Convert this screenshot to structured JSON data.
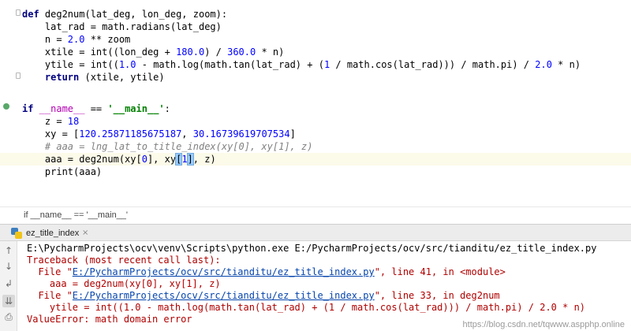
{
  "editor": {
    "lines": {
      "l1_def": "def",
      "l1_rest": " deg2num(lat_deg, lon_deg, zoom):",
      "l2": "    lat_rad = math.radians(lat_deg)",
      "l3_a": "    n = ",
      "l3_num": "2.0",
      "l3_b": " ** zoom",
      "l4_a": "    xtile = int((lon_deg + ",
      "l4_n1": "180.0",
      "l4_b": ") / ",
      "l4_n2": "360.0",
      "l4_c": " * n)",
      "l5_a": "    ytile = int((",
      "l5_n1": "1.0",
      "l5_b": " - math.log(math.tan(lat_rad) + (",
      "l5_n2": "1",
      "l5_c": " / math.cos(lat_rad))) / math.pi) / ",
      "l5_n3": "2.0",
      "l5_d": " * n)",
      "l6_kw": "    return",
      "l6_rest": " (xtile, ytile)",
      "l9_if": "if",
      "l9_name": " __name__",
      "l9_eq": " == ",
      "l9_str": "'__main__'",
      "l9_colon": ":",
      "l10_a": "    z = ",
      "l10_num": "18",
      "l11_a": "    xy = [",
      "l11_n1": "120.25871185675187",
      "l11_b": ", ",
      "l11_n2": "30.16739619707534",
      "l11_c": "]",
      "l12_comment": "    # aaa = lng_lat_to_title_index(xy[0], xy[1], z)",
      "l13_a": "    aaa = deg2num(xy[",
      "l13_n1": "0",
      "l13_b": "], xy",
      "l13_br1": "[",
      "l13_n2": "1",
      "l13_br2": "]",
      "l13_c": ", z)",
      "l14": "    print(aaa)"
    }
  },
  "breadcrumb": {
    "text": "if __name__ == '__main__'"
  },
  "run_panel": {
    "tab_label": "ez_title_index",
    "tab_close": "×",
    "toolbar_icons": [
      "up-arrow-icon",
      "down-arrow-icon",
      "wrap-icon",
      "scroll-to-end-icon",
      "print-icon",
      "trash-icon"
    ],
    "toolbar_glyphs": [
      "↑",
      "↓",
      "↲",
      "⇊",
      "⎙",
      "🗑"
    ],
    "console": {
      "cmd": "E:\\PycharmProjects\\ocv\\venv\\Scripts\\python.exe E:/PycharmProjects/ocv/src/tianditu/ez_title_index.py",
      "traceback": "Traceback (most recent call last):",
      "f1_pre": "  File \"",
      "f1_link": "E:/PycharmProjects/ocv/src/tianditu/ez_title_index.py",
      "f1_post": "\", line 41, in <module>",
      "f1_code": "    aaa = deg2num(xy[0], xy[1], z)",
      "f2_pre": "  File \"",
      "f2_link": "E:/PycharmProjects/ocv/src/tianditu/ez_title_index.py",
      "f2_post": "\", line 33, in deg2num",
      "f2_code": "    ytile = int((1.0 - math.log(math.tan(lat_rad) + (1 / math.cos(lat_rad))) / math.pi) / 2.0 * n)",
      "error": "ValueError: math domain error"
    }
  },
  "watermark": "https://blog.csdn.net/tqwww.aspphp.online",
  "colors": {
    "keyword": "#000080",
    "number": "#0000ff",
    "string": "#008000",
    "comment": "#808080",
    "error": "#b00000",
    "link": "#0645ad",
    "current_line": "#fcfae9"
  }
}
